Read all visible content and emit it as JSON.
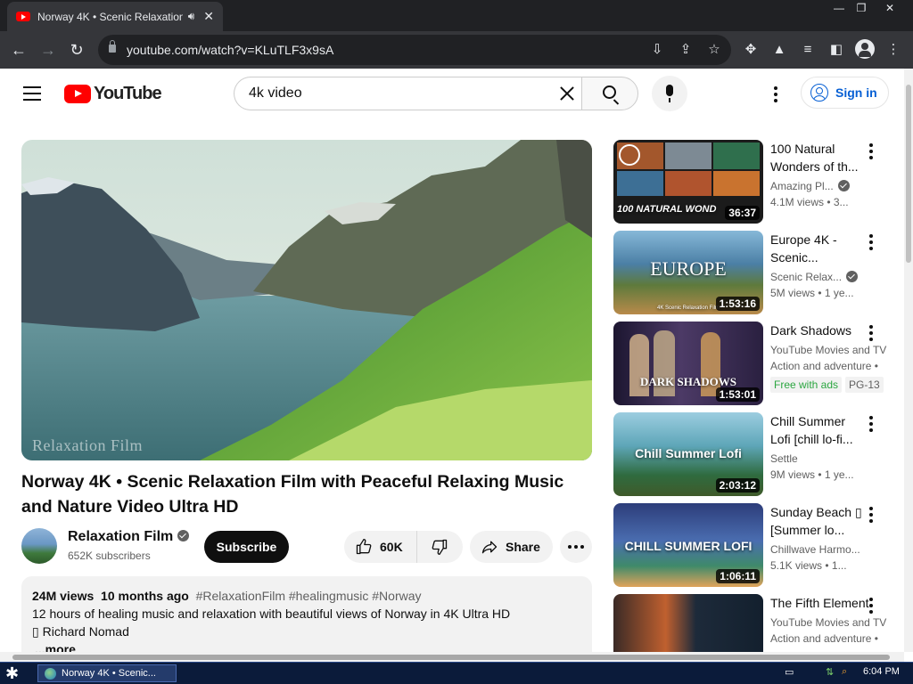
{
  "browser": {
    "tab_title": "Norway 4K • Scenic Relaxation",
    "url": "youtube.com/watch?v=KLuTLF3x9sA"
  },
  "header": {
    "logo_text": "YouTube",
    "search_value": "4k video",
    "signin_label": "Sign in"
  },
  "video": {
    "watermark": "Relaxation Film",
    "title": "Norway 4K • Scenic Relaxation Film with Peaceful Relaxing Music and Nature Video Ultra HD",
    "channel": "Relaxation Film",
    "subscribers": "652K subscribers",
    "subscribe_label": "Subscribe",
    "likes": "60K",
    "share_label": "Share",
    "views": "24M views",
    "age": "10 months ago",
    "hashtags": "#RelaxationFilm #healingmusic #Norway",
    "desc_line1": "12 hours of healing music and relaxation with beautiful views of Norway in 4K Ultra HD",
    "desc_line2": "▯ Richard Nomad",
    "more_label": "...more"
  },
  "recommendations": [
    {
      "title": "100 Natural Wonders of th...",
      "channel": "Amazing Pl...",
      "stats": "4.1M views  • 3...",
      "duration": "36:37",
      "thumb_text": "100 NATURAL WOND"
    },
    {
      "title": "Europe 4K - Scenic...",
      "channel": "Scenic Relax...",
      "stats": "5M views  • 1 ye...",
      "duration": "1:53:16",
      "thumb_text": "EUROPE",
      "thumb_sub": "4K Scenic Relaxation Film"
    },
    {
      "title": "Dark Shadows",
      "channel": "YouTube Movies and TV",
      "stats": "Action and adventure •",
      "duration": "1:53:01",
      "thumb_text": "DARK SHADOWS",
      "badge_free": "Free with ads",
      "badge_rating": "PG-13"
    },
    {
      "title": "Chill Summer Lofi [chill lo-fi...",
      "channel": "Settle",
      "stats": "9M views  • 1 ye...",
      "duration": "2:03:12",
      "thumb_text": "Chill Summer Lofi"
    },
    {
      "title": "Sunday Beach ▯ [Summer lo...",
      "channel": "Chillwave Harmo...",
      "stats": "5.1K views  • 1...",
      "duration": "1:06:11",
      "thumb_text": "CHILL SUMMER LOFI"
    },
    {
      "title": "The Fifth Element",
      "channel": "YouTube Movies and TV",
      "stats": "Action and adventure •",
      "duration": "",
      "thumb_text": ""
    }
  ],
  "taskbar": {
    "task_label": "Norway 4K • Scenic...",
    "clock": "6:04 PM"
  },
  "colors": {
    "youtube_red": "#ff0000",
    "link_blue": "#065fd4",
    "chrome_dark": "#202124",
    "chrome_toolbar": "#35363a"
  }
}
